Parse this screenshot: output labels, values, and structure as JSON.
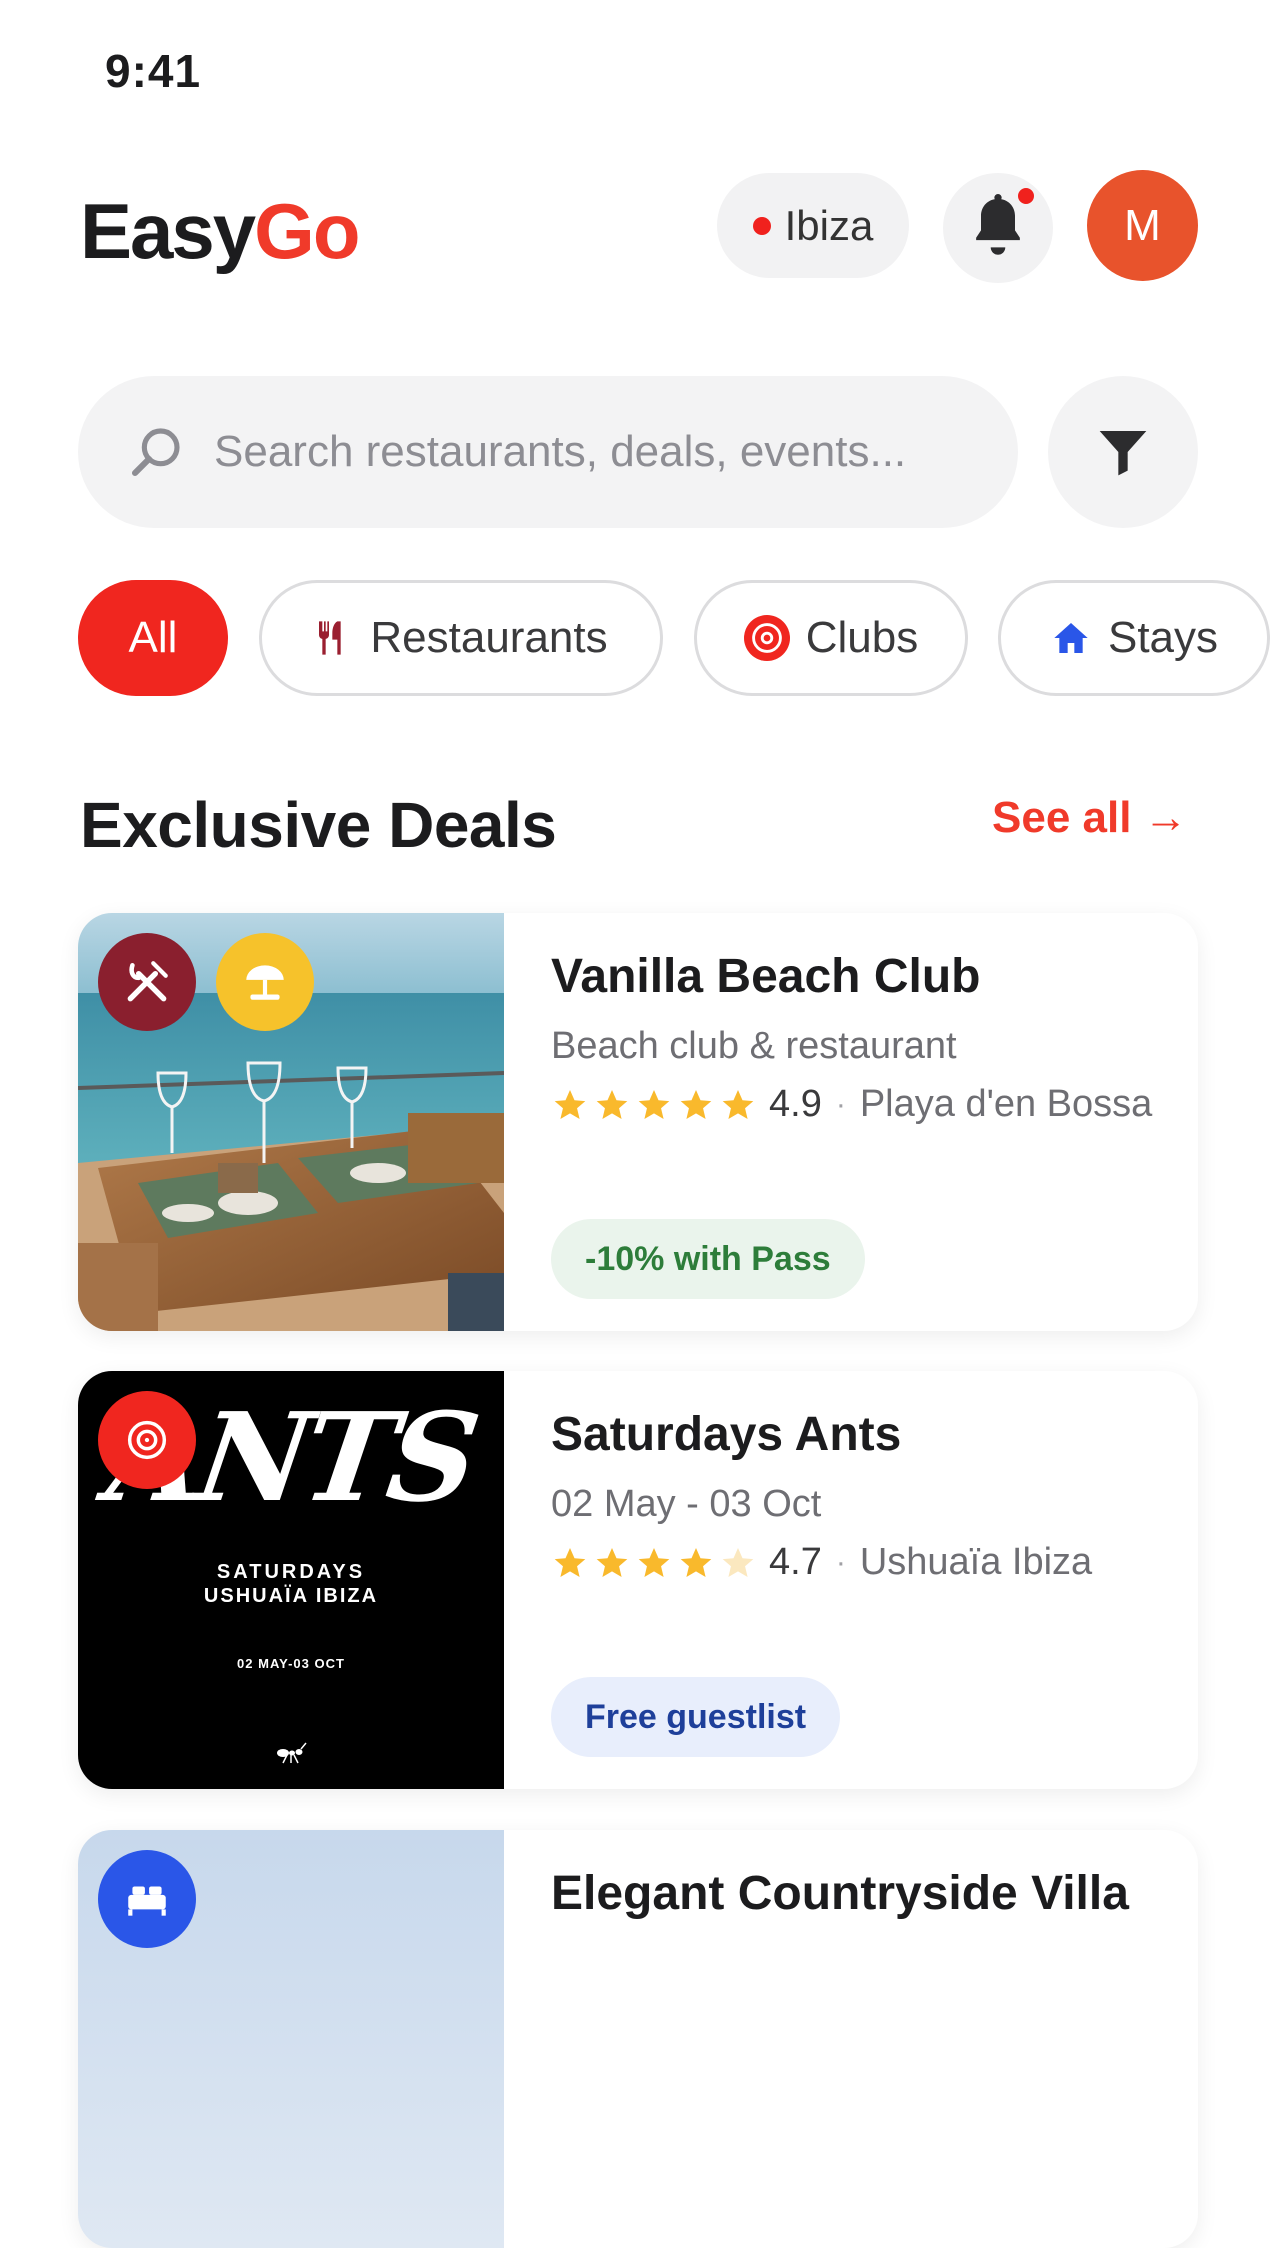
{
  "status": {
    "time": "9:41"
  },
  "header": {
    "logo_part1": "Easy",
    "logo_part2": "Go",
    "location": "Ibiza",
    "avatar_initial": "M"
  },
  "search": {
    "placeholder": "Search restaurants, deals, events..."
  },
  "chips": [
    {
      "label": "All",
      "active": true
    },
    {
      "label": "Restaurants",
      "icon": "fork-knife-icon"
    },
    {
      "label": "Clubs",
      "icon": "vinyl-icon"
    },
    {
      "label": "Stays",
      "icon": "home-icon"
    }
  ],
  "section": {
    "title": "Exclusive Deals",
    "see_all": "See all →"
  },
  "deals": [
    {
      "title": "Vanilla Beach Club",
      "subtitle": "Beach club & restaurant",
      "rating": "4.9",
      "stars": 5,
      "location": "Playa d'en Bossa",
      "badge": "-10% with Pass",
      "icons": [
        "fork-knife-icon",
        "beach-umbrella-icon"
      ]
    },
    {
      "title": "Saturdays Ants",
      "subtitle": "02 May - 03 Oct",
      "rating": "4.7",
      "stars": 4,
      "location": "Ushuaïa Ibiza",
      "badge": "Free guestlist",
      "icons": [
        "vinyl-icon"
      ],
      "poster": {
        "brand": "ANTS",
        "line1": "SATURDAYS",
        "line2": "USHUAÏA IBIZA",
        "dates": "02 MAY-03 OCT"
      }
    },
    {
      "title": "Elegant Countryside Villa",
      "icons": [
        "bed-icon"
      ]
    }
  ],
  "colors": {
    "brand_red": "#f03a2a",
    "chip_active": "#f0261f",
    "avatar": "#e8532c",
    "star": "#f9b92c",
    "restaurant_badge": "#8a1f2e",
    "beach_badge": "#f6c22b",
    "club_badge": "#f0261f",
    "stay_badge": "#2a56e8"
  }
}
